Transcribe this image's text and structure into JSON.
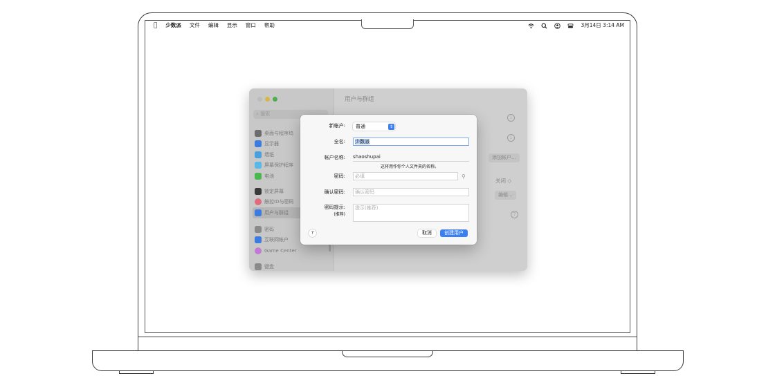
{
  "menubar": {
    "app_name": "少数派",
    "menus": [
      "文件",
      "编辑",
      "显示",
      "窗口",
      "帮助"
    ],
    "datetime": "3月14日 3:14 AM",
    "status_icons": [
      "wifi-icon",
      "search-icon",
      "user-icon",
      "control-center-icon"
    ]
  },
  "settings": {
    "title": "用户与群组",
    "search_placeholder": "搜索",
    "sidebar_groups": [
      [
        {
          "label": "桌面与程序坞",
          "icon": "dock-icon",
          "color": "#6d6d6d"
        },
        {
          "label": "显示器",
          "icon": "display-icon",
          "color": "#3c7be0"
        },
        {
          "label": "墙纸",
          "icon": "wallpaper-icon",
          "color": "#49a0e0"
        },
        {
          "label": "屏幕保护程序",
          "icon": "screensaver-icon",
          "color": "#58b8e8"
        },
        {
          "label": "电池",
          "icon": "battery-icon",
          "color": "#49b84f"
        }
      ],
      [
        {
          "label": "锁定屏幕",
          "icon": "lock-icon",
          "color": "#3a3a3a"
        },
        {
          "label": "触控ID与密码",
          "icon": "fingerprint-icon",
          "color": "#e06b7a"
        },
        {
          "label": "用户与群组",
          "icon": "users-icon",
          "color": "#3c7be0",
          "selected": true
        }
      ],
      [
        {
          "label": "密码",
          "icon": "key-icon",
          "color": "#8a8a8a"
        },
        {
          "label": "互联网帐户",
          "icon": "at-icon",
          "color": "#3c7be0"
        },
        {
          "label": "Game Center",
          "icon": "game-center-icon",
          "color": "#c27ad6"
        }
      ],
      [
        {
          "label": "键盘",
          "icon": "keyboard-icon",
          "color": "#8a8a8a"
        }
      ]
    ],
    "add_account_label": "添加帐户...",
    "off_label": "关闭 ◇",
    "edit_label": "编辑..."
  },
  "dialog": {
    "new_account_label": "新帐户:",
    "account_type": "普通",
    "full_name_label": "全名:",
    "full_name_value": "少数派",
    "account_name_label": "帐户名称:",
    "account_name_value": "shaoshupai",
    "account_name_note": "这将用作你个人文件夹的名称。",
    "password_label": "密码:",
    "password_placeholder": "必填",
    "verify_label": "确认密码:",
    "verify_placeholder": "确认密码",
    "hint_label": "密码提示:",
    "hint_sublabel": "(推荐)",
    "hint_placeholder": "提示(推荐)",
    "help_label": "?",
    "cancel_label": "取消",
    "create_label": "创建用户",
    "accent_color": "#3b7ff0"
  }
}
